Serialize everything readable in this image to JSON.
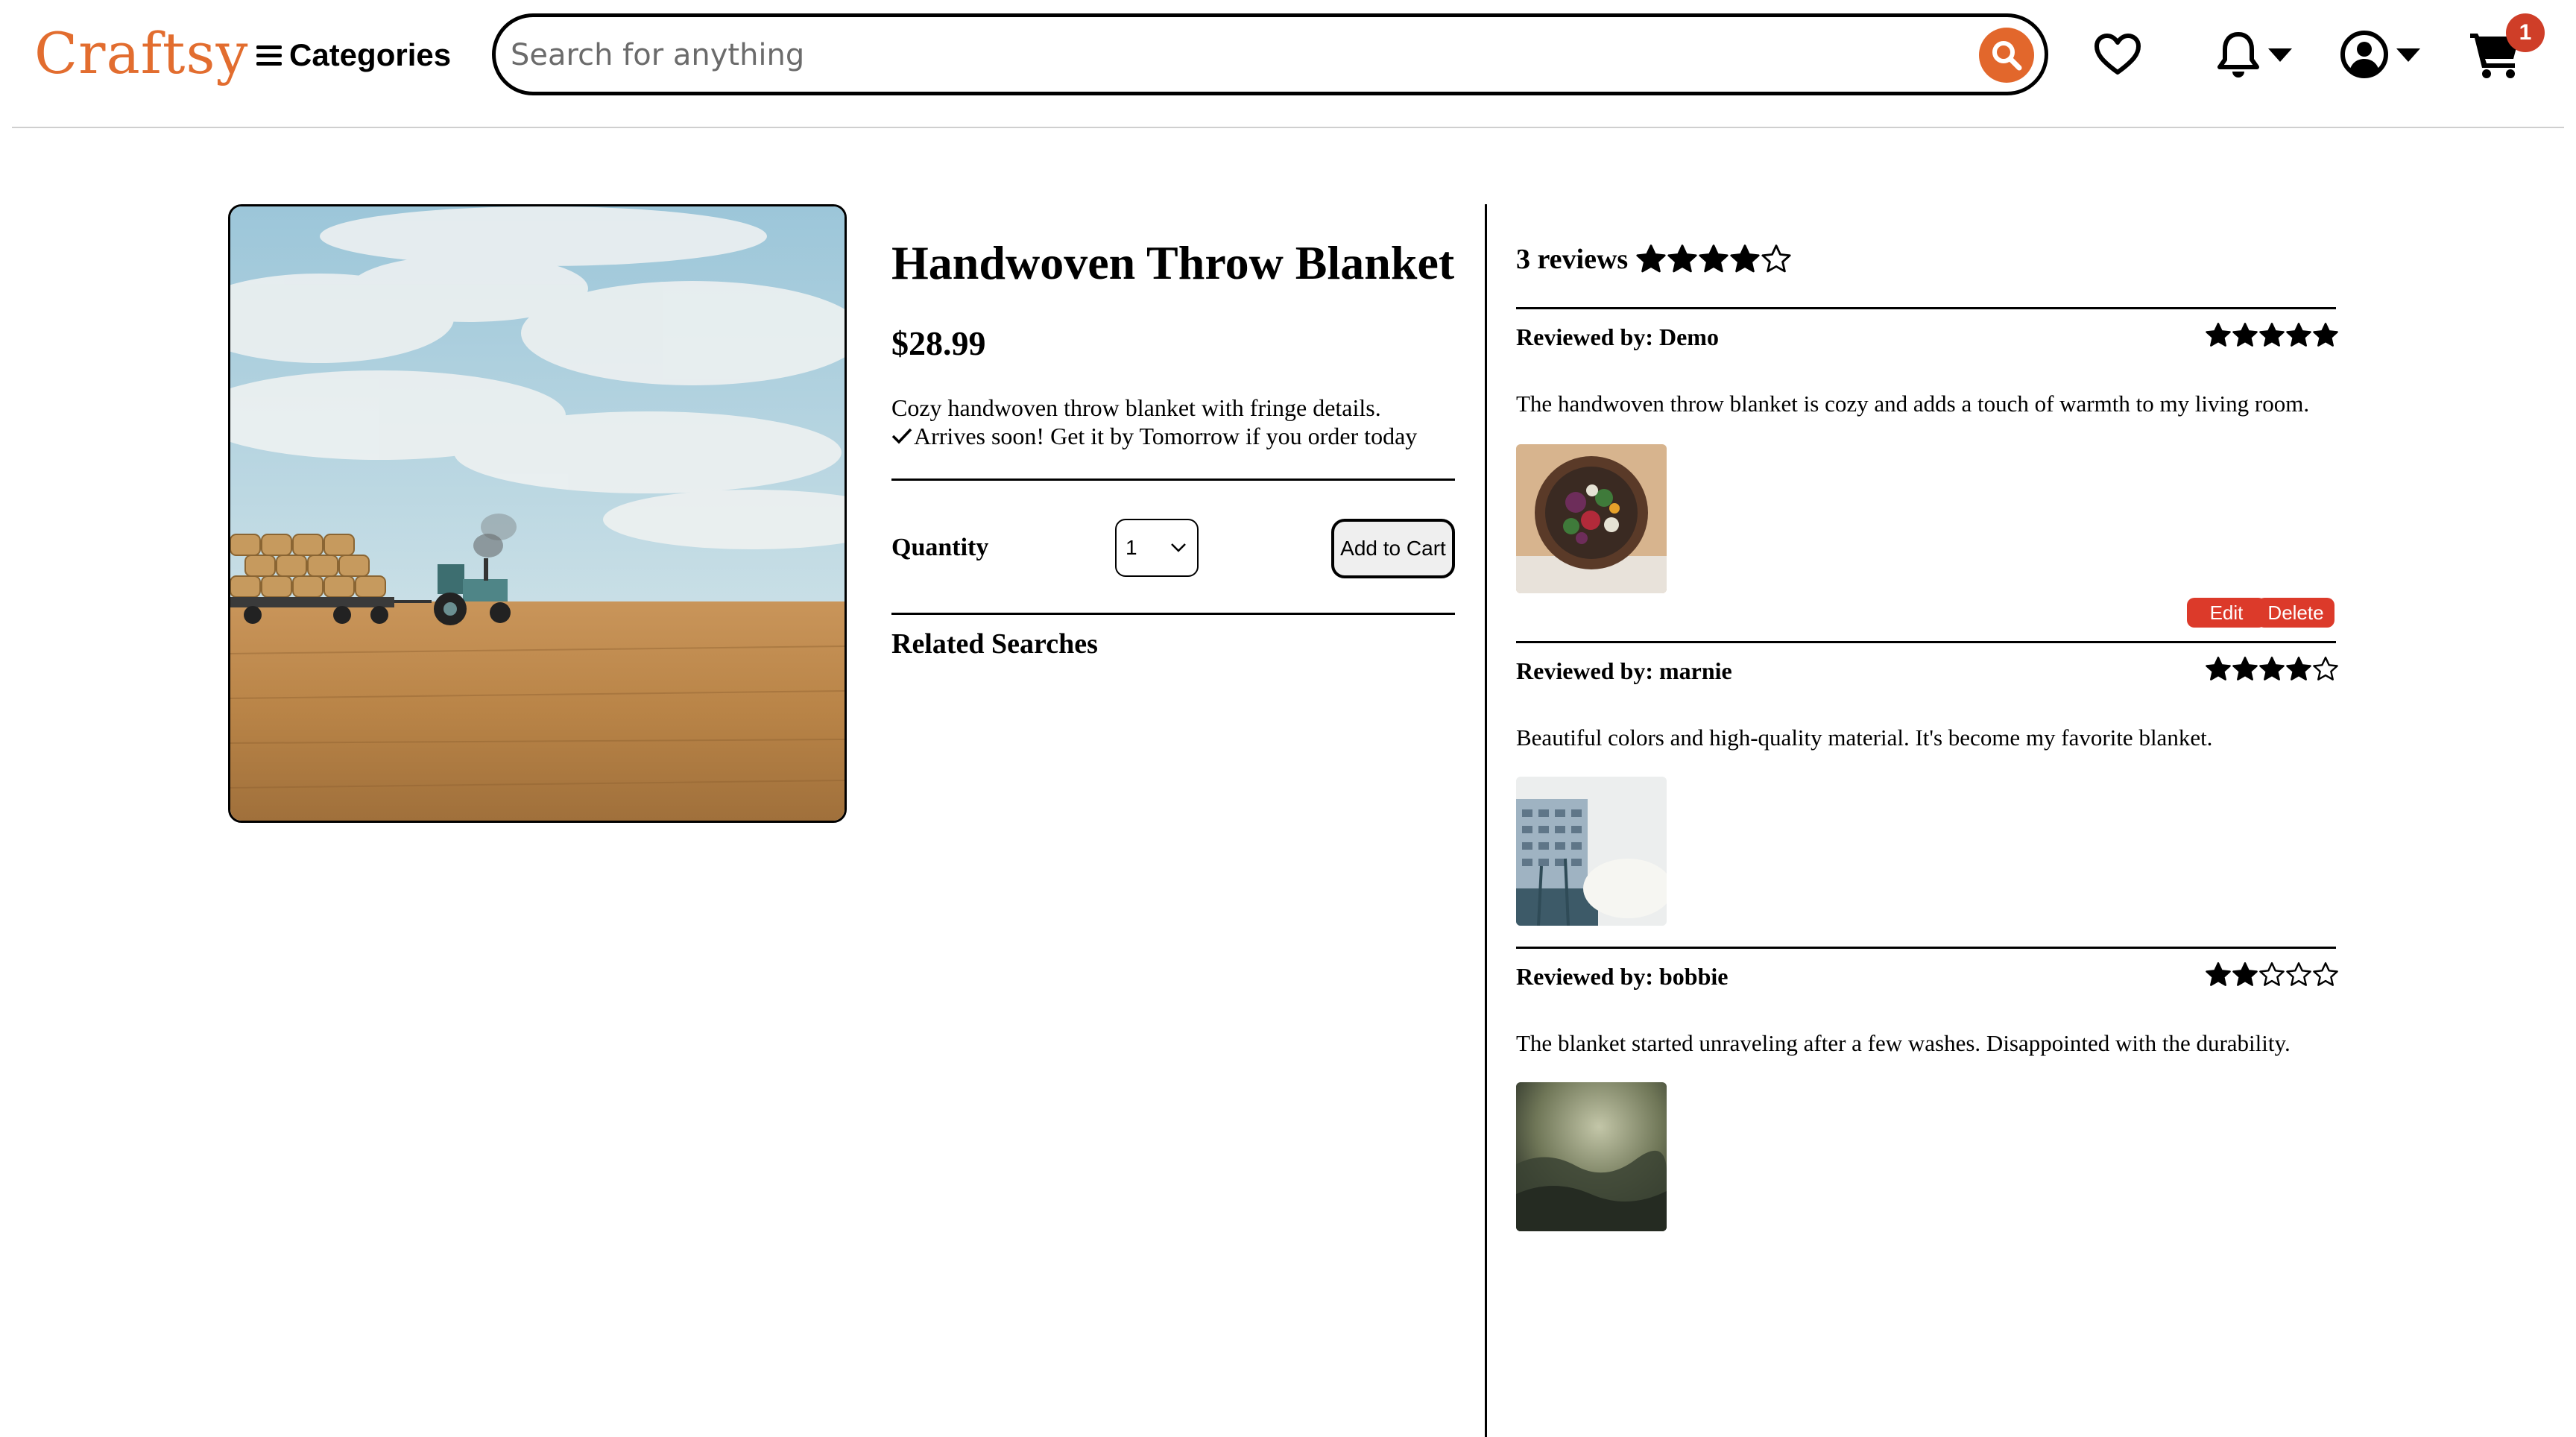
{
  "header": {
    "logo": "Craftsy",
    "categories_label": "Categories",
    "search_placeholder": "Search for anything",
    "cart_count": "1",
    "accent_color": "#e2672c"
  },
  "product": {
    "title": "Handwoven Throw Blanket",
    "price": "$28.99",
    "description": "Cozy handwoven throw blanket with fringe details.",
    "delivery": "Arrives soon! Get it by Tomorrow if you order today",
    "quantity_label": "Quantity",
    "quantity_value": "1",
    "add_to_cart_label": "Add to Cart",
    "related_label": "Related Searches"
  },
  "reviews": {
    "count_label": "3 reviews",
    "average_rating": 4,
    "items": [
      {
        "reviewer": "Reviewed by: Demo",
        "rating": 5,
        "text": "The handwoven throw blanket is cozy and adds a touch of warmth to my living room.",
        "photo": "bowl-of-salad",
        "edit_label": "Edit",
        "delete_label": "Delete"
      },
      {
        "reviewer": "Reviewed by: marnie",
        "rating": 4,
        "text": "Beautiful colors and high-quality material. It's become my favorite blanket.",
        "photo": "building-and-palms"
      },
      {
        "reviewer": "Reviewed by: bobbie",
        "rating": 2,
        "text": "The blanket started unraveling after a few washes. Disappointed with the durability.",
        "photo": "misty-forest"
      }
    ]
  }
}
